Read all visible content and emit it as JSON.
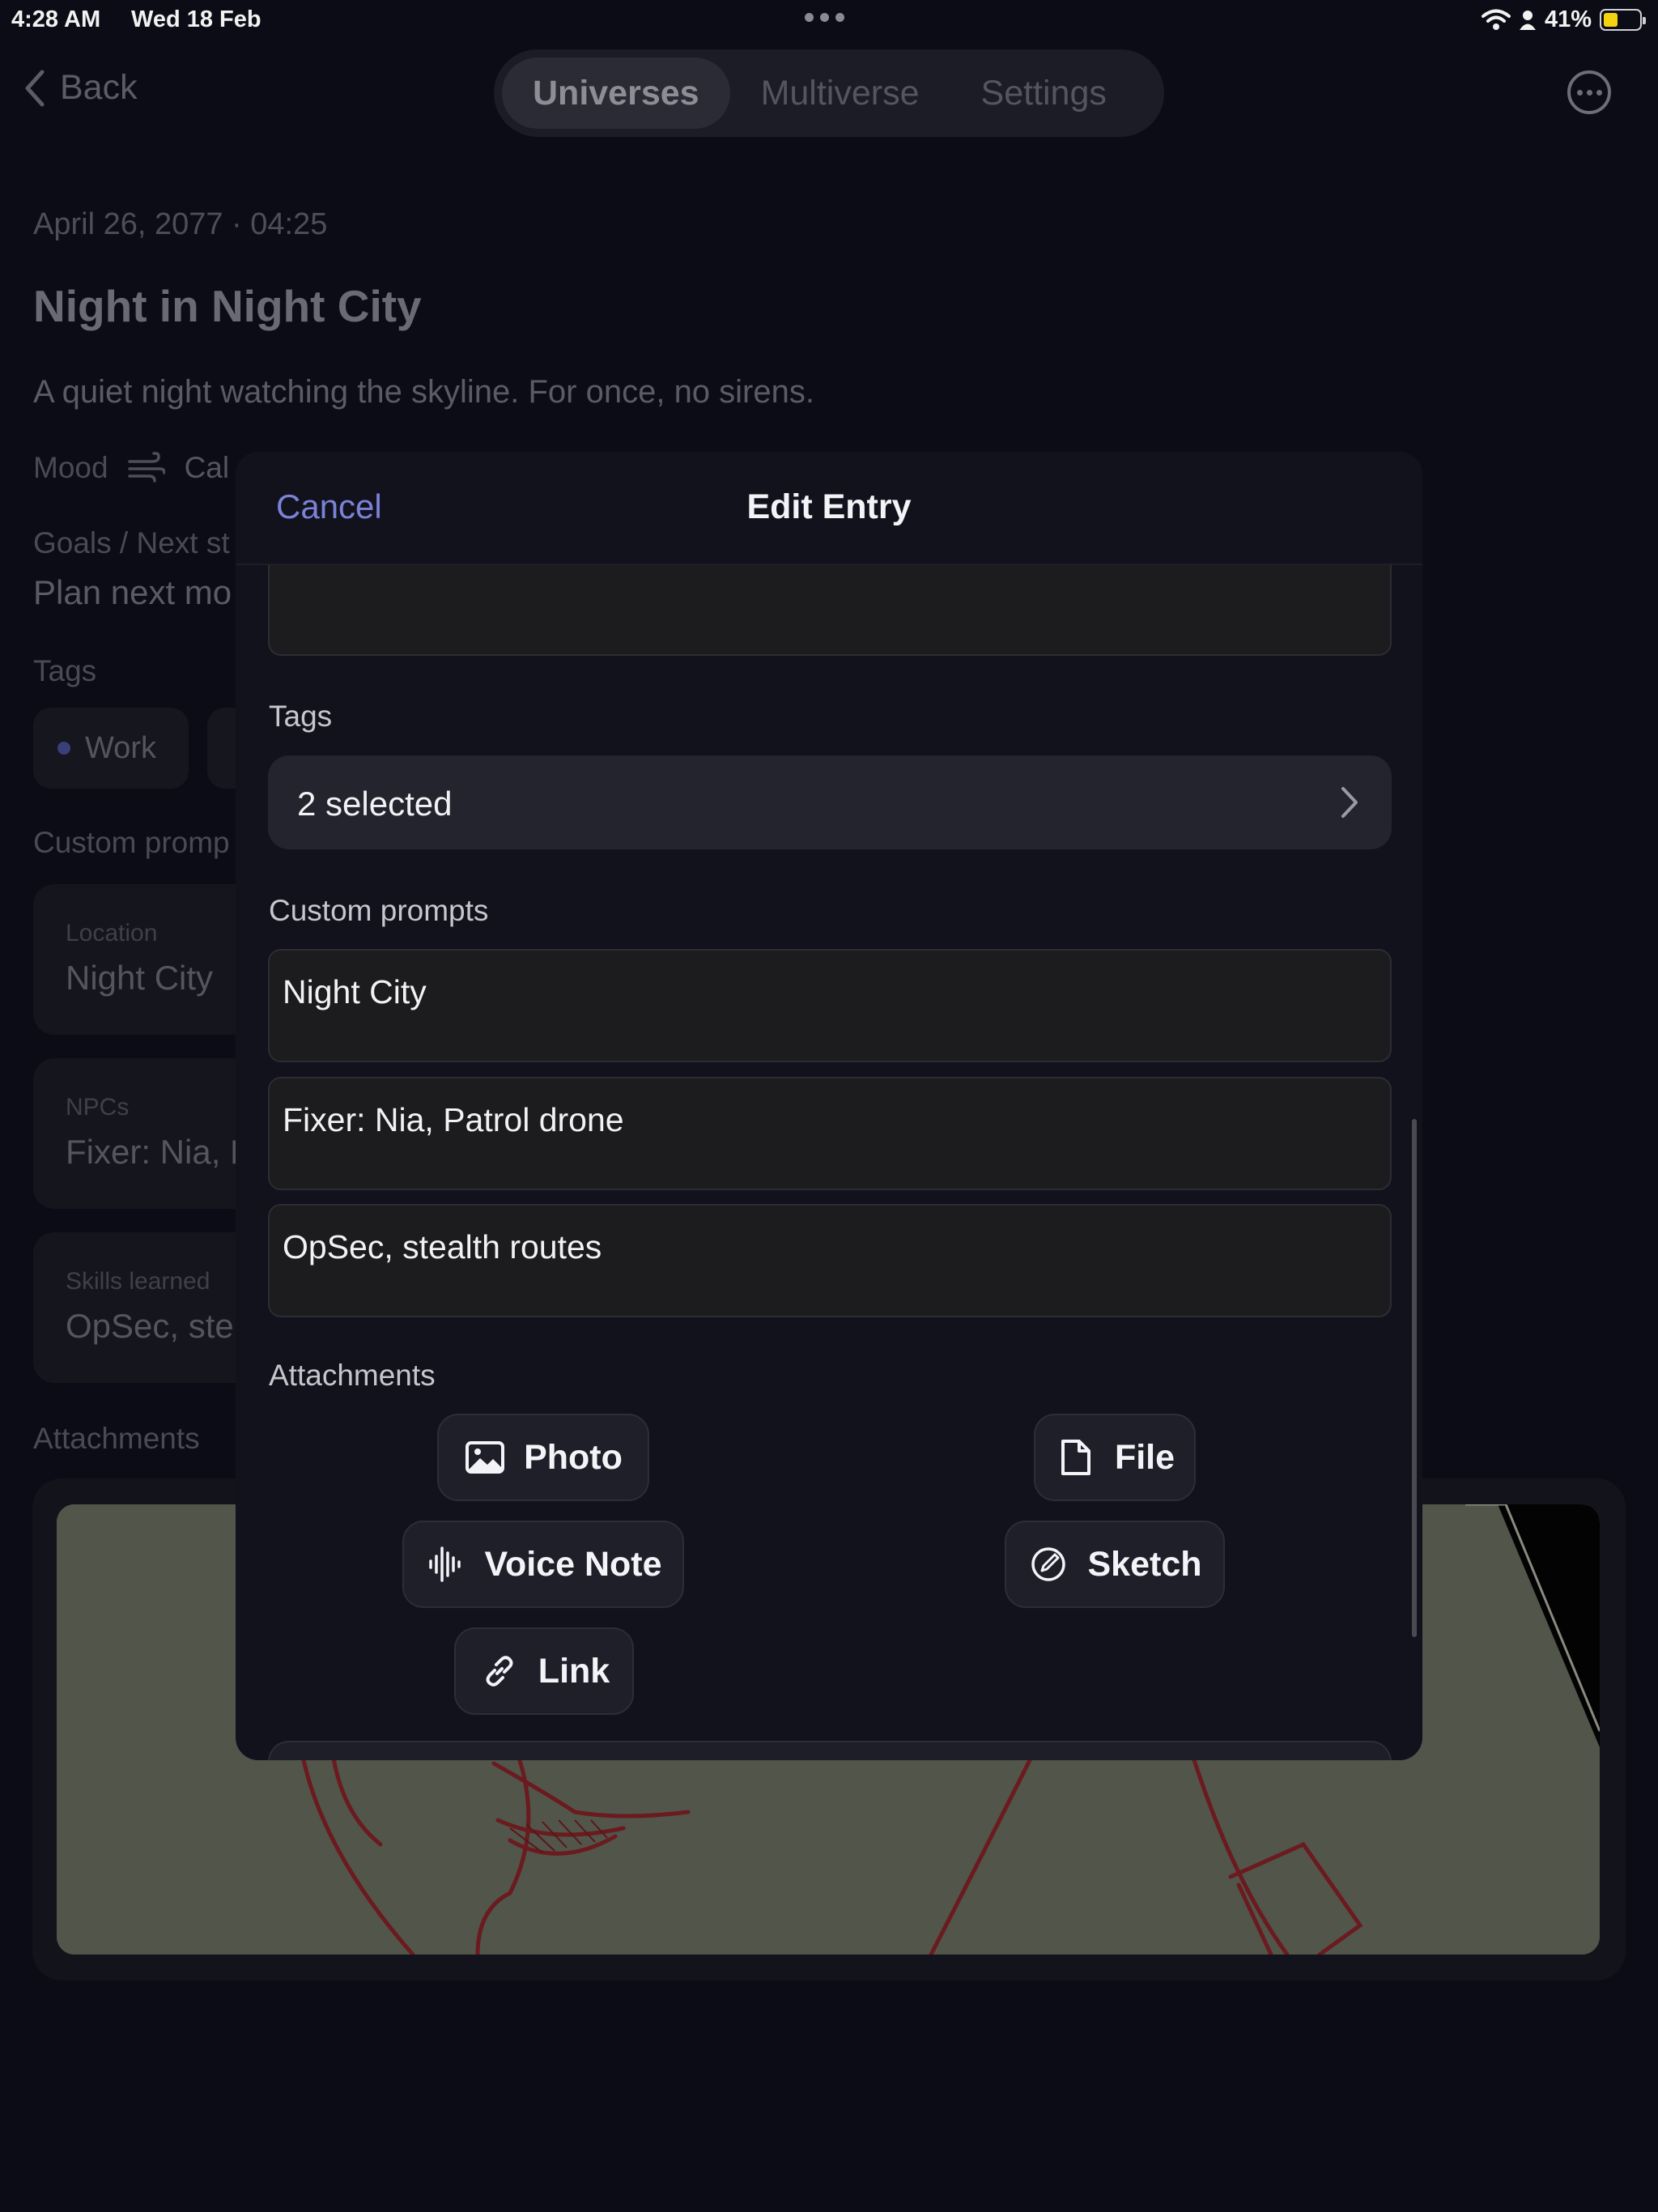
{
  "status_bar": {
    "time": "4:28 AM",
    "date": "Wed 18 Feb",
    "battery": "41%",
    "battery_fraction": 0.41
  },
  "nav": {
    "back_label": "Back",
    "tabs": [
      {
        "label": "Universes",
        "active": true
      },
      {
        "label": "Multiverse",
        "active": false
      },
      {
        "label": "Settings",
        "active": false
      }
    ]
  },
  "entry": {
    "date": "April 26, 2077 · 04:25",
    "title": "Night in Night City",
    "subtitle": "A quiet night watching the skyline. For once, no sirens.",
    "mood_label": "Mood",
    "mood_value": "Cal",
    "goals_label": "Goals / Next st",
    "goals_value": "Plan next mo",
    "tags_label": "Tags",
    "tag_1": "Work",
    "custom_label": "Custom promp",
    "cards": [
      {
        "key": "Location",
        "value": "Night City"
      },
      {
        "key": "NPCs",
        "value": "Fixer: Nia, P"
      },
      {
        "key": "Skills learned",
        "value": "OpSec, ste"
      }
    ],
    "attachments_label": "Attachments"
  },
  "sheet": {
    "cancel_label": "Cancel",
    "title": "Edit Entry",
    "tags_label": "Tags",
    "tags_value": "2 selected",
    "custom_prompts_label": "Custom prompts",
    "prompt_1": "Night City",
    "prompt_2": "Fixer: Nia, Patrol drone",
    "prompt_3": "OpSec, stealth routes",
    "attachments_label": "Attachments",
    "buttons": {
      "photo": "Photo",
      "file": "File",
      "voice_note": "Voice Note",
      "sketch": "Sketch",
      "link": "Link"
    }
  },
  "colors": {
    "accent": "#7b82d8",
    "sheet_bg": "#12121d",
    "page_bg": "#0c0c16",
    "battery": "#f5d20f"
  }
}
